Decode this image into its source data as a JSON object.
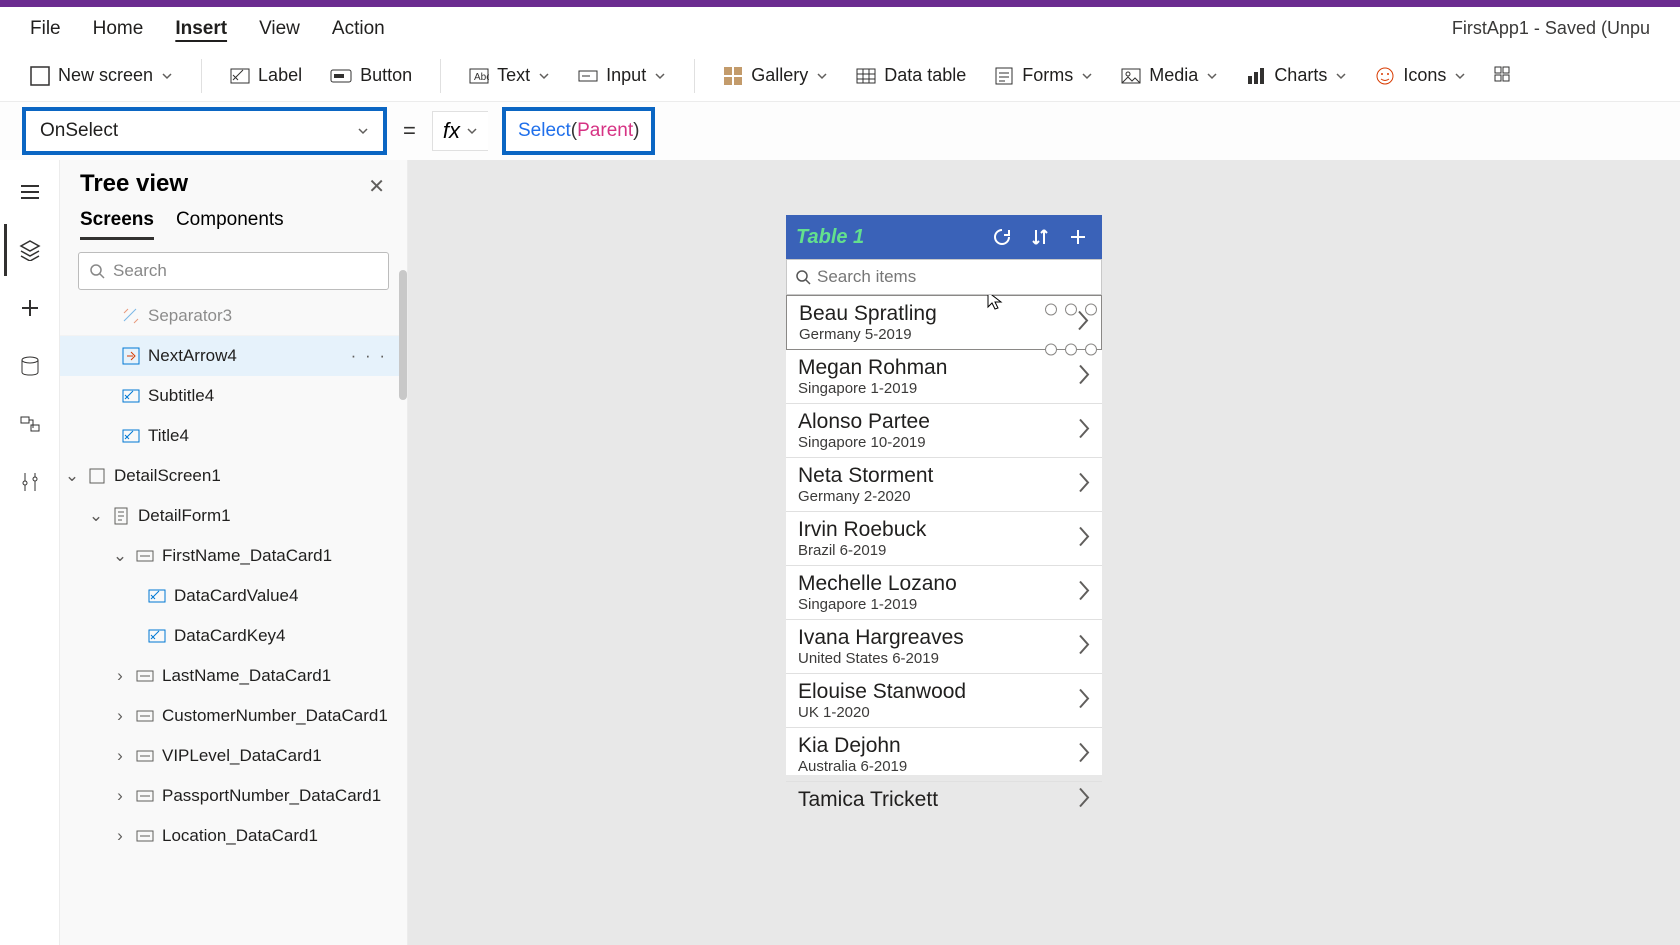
{
  "menu": {
    "file": "File",
    "home": "Home",
    "insert": "Insert",
    "view": "View",
    "action": "Action"
  },
  "app_title": "FirstApp1 - Saved (Unpu",
  "ribbon": {
    "newscreen": "New screen",
    "label": "Label",
    "button": "Button",
    "text": "Text",
    "input": "Input",
    "gallery": "Gallery",
    "datatable": "Data table",
    "forms": "Forms",
    "media": "Media",
    "charts": "Charts",
    "icons": "Icons"
  },
  "property": {
    "name": "OnSelect",
    "formula_kw": "Select",
    "formula_id": "Parent"
  },
  "tree": {
    "title": "Tree view",
    "tab_screens": "Screens",
    "tab_components": "Components",
    "search_placeholder": "Search",
    "items": {
      "separator": "Separator3",
      "nextarrow": "NextArrow4",
      "subtitle": "Subtitle4",
      "title": "Title4",
      "detailscreen": "DetailScreen1",
      "detailform": "DetailForm1",
      "firstname": "FirstName_DataCard1",
      "dcvalue": "DataCardValue4",
      "dckey": "DataCardKey4",
      "lastname": "LastName_DataCard1",
      "customernum": "CustomerNumber_DataCard1",
      "vip": "VIPLevel_DataCard1",
      "passport": "PassportNumber_DataCard1",
      "location": "Location_DataCard1"
    }
  },
  "phone": {
    "title": "Table 1",
    "search_placeholder": "Search items",
    "rows": [
      {
        "name": "Beau Spratling",
        "sub": "Germany 5-2019"
      },
      {
        "name": "Megan Rohman",
        "sub": "Singapore 1-2019"
      },
      {
        "name": "Alonso Partee",
        "sub": "Singapore 10-2019"
      },
      {
        "name": "Neta Storment",
        "sub": "Germany 2-2020"
      },
      {
        "name": "Irvin Roebuck",
        "sub": "Brazil 6-2019"
      },
      {
        "name": "Mechelle Lozano",
        "sub": "Singapore 1-2019"
      },
      {
        "name": "Ivana Hargreaves",
        "sub": "United States 6-2019"
      },
      {
        "name": "Elouise Stanwood",
        "sub": "UK 1-2020"
      },
      {
        "name": "Kia Dejohn",
        "sub": "Australia 6-2019"
      },
      {
        "name": "Tamica Trickett",
        "sub": ""
      }
    ]
  }
}
